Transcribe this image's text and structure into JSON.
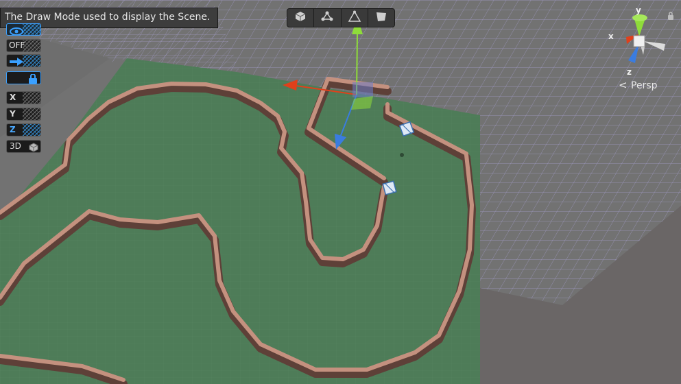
{
  "tooltip": {
    "text": "The Draw Mode used to display the Scene."
  },
  "left_toolbar": {
    "items": [
      {
        "name": "draw-mode-button",
        "label": "",
        "icon": "eye-icon"
      },
      {
        "name": "snap-toggle",
        "label": "OFF"
      },
      {
        "name": "move-snap-button",
        "label": "",
        "icon": "arrow-right-icon"
      },
      {
        "name": "lock-toggle",
        "label": "",
        "icon": "lock-icon"
      },
      {
        "name": "grid-x-button",
        "label": "X"
      },
      {
        "name": "grid-y-button",
        "label": "Y"
      },
      {
        "name": "grid-z-button",
        "label": "Z"
      },
      {
        "name": "grid-3d-button",
        "label": "3D"
      }
    ]
  },
  "top_toolbar": {
    "tools": [
      {
        "name": "cube-tool",
        "icon": "cube-icon"
      },
      {
        "name": "nodes-tool",
        "icon": "nodes-icon"
      },
      {
        "name": "vertex-tool",
        "icon": "triangle-vertex-icon"
      },
      {
        "name": "face-tool",
        "icon": "face-icon"
      }
    ]
  },
  "gizmo": {
    "x_label": "x",
    "y_label": "y",
    "z_label": "z"
  },
  "projection": {
    "label": "Persp"
  },
  "colors": {
    "ground": "#4e7c58",
    "wall": "#c4917f",
    "wall_dark": "#5e4038",
    "grid_bg": "#737373",
    "grid_line": "#9e95c8",
    "axis_x": "#e0401b",
    "axis_y": "#8fdc3a",
    "axis_z": "#3a7ce0"
  }
}
